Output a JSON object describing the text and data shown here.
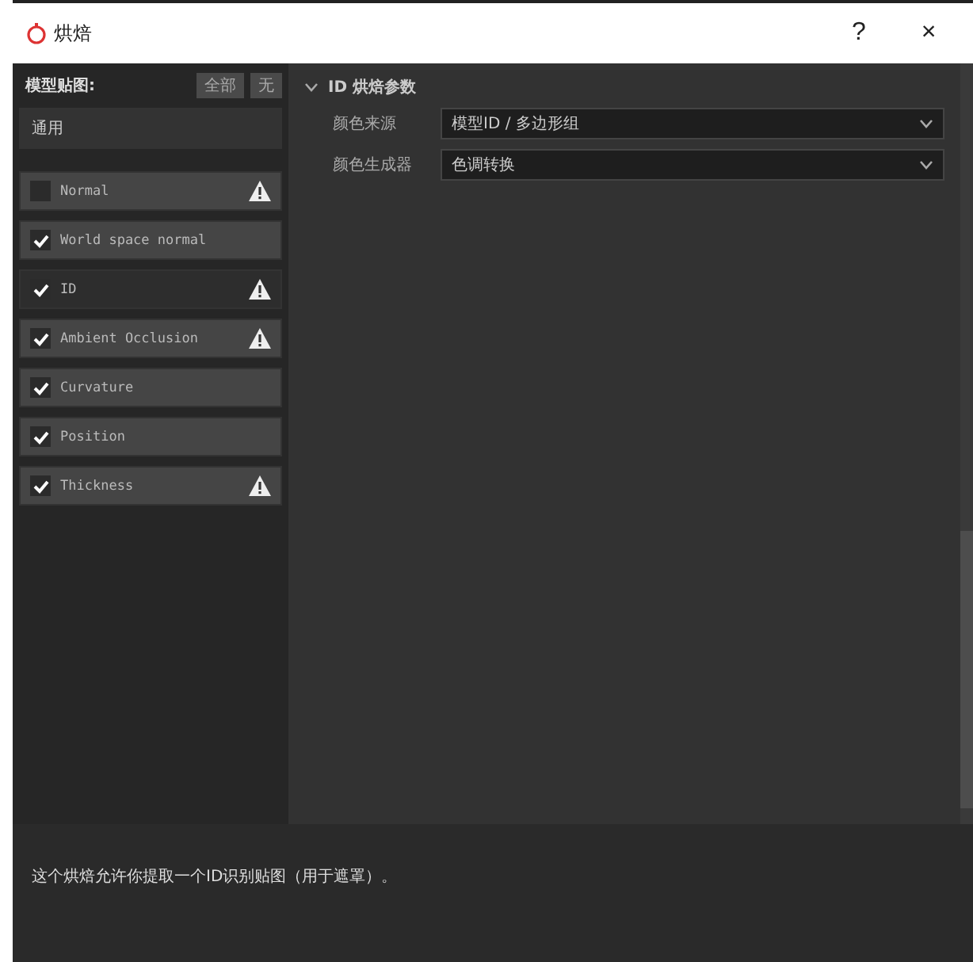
{
  "window": {
    "title": "烘焙",
    "help": "?",
    "close": "×"
  },
  "sidebar": {
    "title": "模型贴图:",
    "buttons": [
      "全部",
      "无"
    ],
    "group": "通用",
    "items": [
      {
        "label": "Normal",
        "checked": false,
        "warning": true,
        "selected": false
      },
      {
        "label": "World space normal",
        "checked": true,
        "warning": false,
        "selected": false
      },
      {
        "label": "ID",
        "checked": true,
        "warning": true,
        "selected": true
      },
      {
        "label": "Ambient Occlusion",
        "checked": true,
        "warning": true,
        "selected": false
      },
      {
        "label": "Curvature",
        "checked": true,
        "warning": false,
        "selected": false
      },
      {
        "label": "Position",
        "checked": true,
        "warning": false,
        "selected": false
      },
      {
        "label": "Thickness",
        "checked": true,
        "warning": true,
        "selected": false
      }
    ]
  },
  "section": {
    "title": "ID 烘焙参数",
    "expanded": true,
    "fields": [
      {
        "label": "颜色来源",
        "value": "模型ID / 多边形组"
      },
      {
        "label": "颜色生成器",
        "value": "色调转换"
      }
    ]
  },
  "description": "这个烘焙允许你提取一个ID识别贴图（用于遮罩）。"
}
